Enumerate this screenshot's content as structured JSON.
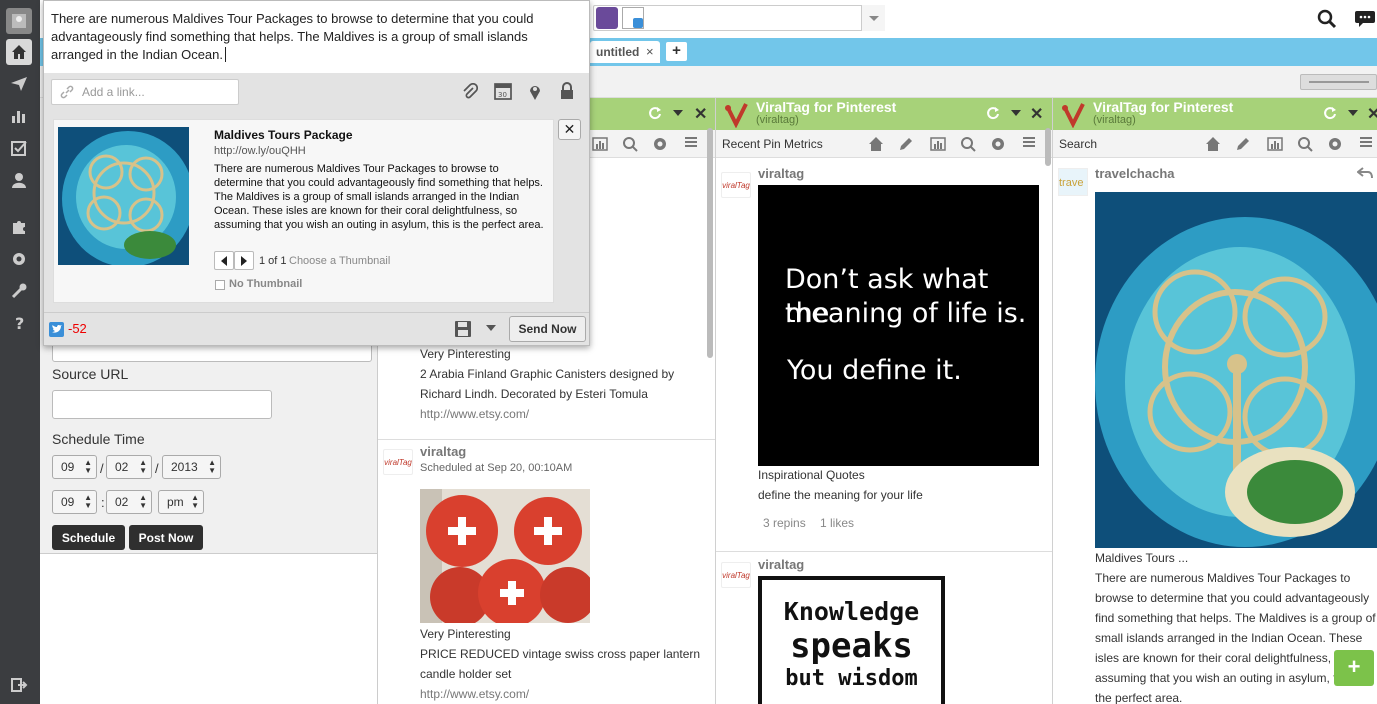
{
  "compose": {
    "message": "There are numerous Maldives Tour Packages to browse to determine that you could advantageously find something that helps. The Maldives is a group of small islands arranged in the Indian Ocean.",
    "link_placeholder": "Add a link...",
    "preview": {
      "title": "Maldives Tours Package",
      "url": "http://ow.ly/ouQHH",
      "description": "There are numerous Maldives Tour Packages to browse to determine that you could advantageously find something that helps. The Maldives is a group of small islands arranged in the Indian Ocean. These isles are known for their coral delightfulness, so assuming that you wish an outing in asylum, this is the perfect area.",
      "pager": "1 of 1",
      "choose_thumbnail": "Choose a Thumbnail",
      "no_thumbnail": "No Thumbnail"
    },
    "char_count": "-52",
    "send_label": "Send Now"
  },
  "tabs": {
    "active": "untitled",
    "add_icon": "plus-icon"
  },
  "form": {
    "source_url_label": "Source URL",
    "schedule_label": "Schedule Time",
    "month": "09",
    "day": "02",
    "year": "2013",
    "hour": "09",
    "minute": "02",
    "ampm": "pm",
    "sep_slash": "/",
    "sep_colon": ":",
    "schedule_btn": "Schedule",
    "post_now_btn": "Post Now"
  },
  "column1": {
    "post1": {
      "board": "Very Pinteresting",
      "desc": "2 Arabia Finland Graphic Canisters designed by Richard Lindh. Decorated by Esteri Tomula",
      "link": "http://www.etsy.com/"
    },
    "post2": {
      "user": "viraltag",
      "scheduled": "Scheduled at Sep 20, 00:10AM",
      "board": "Very Pinteresting",
      "desc": "PRICE REDUCED vintage swiss cross paper lantern candle holder set",
      "link": "http://www.etsy.com/"
    }
  },
  "column2": {
    "title": "ViralTag for Pinterest",
    "subtitle": "(viraltag)",
    "toolbar_label": "Recent Pin Metrics",
    "post1": {
      "user": "viraltag",
      "quote_line1": "Don’t ask what the",
      "quote_line2": "meaning of life is.",
      "quote_line3": "You define it.",
      "board": "Inspirational Quotes",
      "desc": "define the meaning for your life",
      "repins": "3 repins",
      "likes": "1 likes"
    },
    "post2": {
      "user": "viraltag",
      "img_line1": "Knowledge",
      "img_line2": "speaks",
      "img_line3": "but wisdom"
    }
  },
  "column3": {
    "title": "ViralTag for Pinterest",
    "subtitle": "(viraltag)",
    "toolbar_label": "Search",
    "post1": {
      "user": "travelchacha",
      "title": "Maldives Tours ...",
      "desc": "There are numerous Maldives Tour Packages to browse to determine that you could advantageously find something that helps. The Maldives is a group of small islands arranged in the Indian Ocean. These isles are known for their coral delightfulness, so assuming that you wish an outing in asylum, this is the perfect area."
    }
  },
  "avatar_text": "viralTag",
  "avatar2_text": "trave"
}
